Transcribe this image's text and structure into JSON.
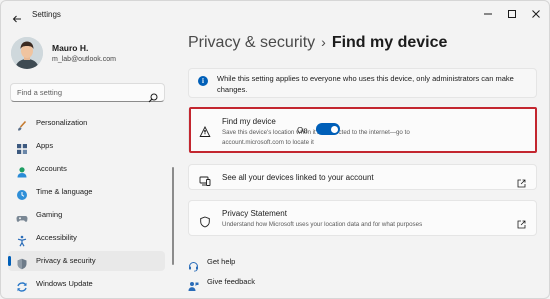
{
  "window": {
    "title": "Settings",
    "controls": [
      "minimize-icon",
      "maximize-icon",
      "close-icon"
    ]
  },
  "profile": {
    "name": "Mauro H.",
    "email": "m_lab@outlook.com"
  },
  "search": {
    "placeholder": "Find a setting"
  },
  "sidebar": {
    "items": [
      {
        "label": "Personalization",
        "icon": "brush-icon",
        "active": false
      },
      {
        "label": "Apps",
        "icon": "apps-icon",
        "active": false
      },
      {
        "label": "Accounts",
        "icon": "person-icon",
        "active": false
      },
      {
        "label": "Time & language",
        "icon": "globe-clock-icon",
        "active": false
      },
      {
        "label": "Gaming",
        "icon": "gamepad-icon",
        "active": false
      },
      {
        "label": "Accessibility",
        "icon": "accessibility-icon",
        "active": false
      },
      {
        "label": "Privacy & security",
        "icon": "shield-icon",
        "active": true
      },
      {
        "label": "Windows Update",
        "icon": "update-icon",
        "active": false
      }
    ]
  },
  "header": {
    "parent": "Privacy & security",
    "separator": "›",
    "current": "Find my device"
  },
  "info": {
    "text": "While this setting applies to everyone who uses this device, only administrators can make changes."
  },
  "find_my_device": {
    "title": "Find my device",
    "description": "Save this device's location when it's connected to the internet—go to account.microsoft.com to locate it",
    "state_label": "On",
    "enabled": true
  },
  "devices_link": {
    "title": "See all your devices linked to your account"
  },
  "privacy_statement": {
    "title": "Privacy Statement",
    "description": "Understand how Microsoft uses your location data and for what purposes"
  },
  "help": {
    "get_help": "Get help",
    "give_feedback": "Give feedback"
  },
  "colors": {
    "accent": "#005fb8",
    "highlight_border": "#c3262f"
  }
}
